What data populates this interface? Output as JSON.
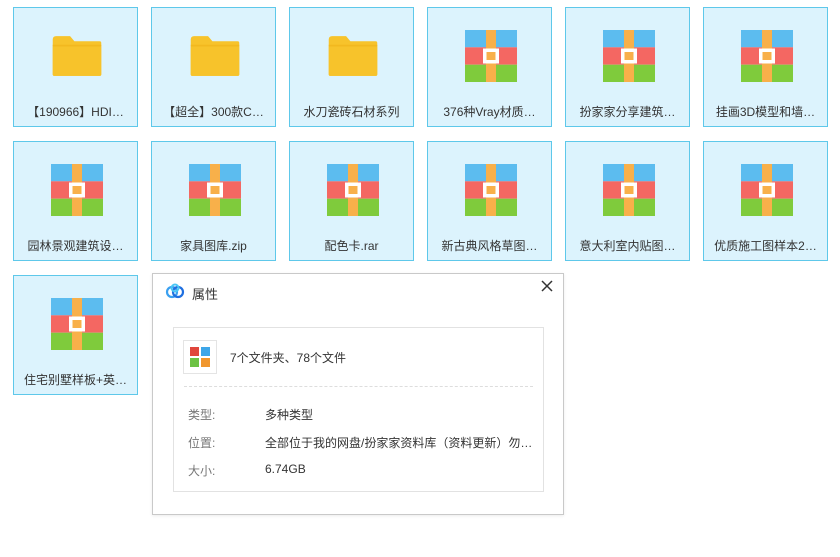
{
  "items": [
    {
      "label": "【190966】HDI…",
      "type": "folder"
    },
    {
      "label": "【超全】300款C…",
      "type": "folder"
    },
    {
      "label": "水刀瓷砖石材系列",
      "type": "folder"
    },
    {
      "label": "376种Vray材质…",
      "type": "archive"
    },
    {
      "label": "扮家家分享建筑…",
      "type": "archive"
    },
    {
      "label": "挂画3D模型和墙…",
      "type": "archive"
    },
    {
      "label": "园林景观建筑设…",
      "type": "archive"
    },
    {
      "label": "家具图库.zip",
      "type": "archive"
    },
    {
      "label": "配色卡.rar",
      "type": "archive"
    },
    {
      "label": "新古典风格草图…",
      "type": "archive"
    },
    {
      "label": "意大利室内贴图…",
      "type": "archive"
    },
    {
      "label": "优质施工图样本2…",
      "type": "archive"
    },
    {
      "label": "住宅别墅样板+英…",
      "type": "archive"
    }
  ],
  "dialog": {
    "title": "属性",
    "title_icon": "baidu-netdisk-cloud-icon",
    "close_icon": "close-icon",
    "summary": "7个文件夹、78个文件",
    "summary_icon": "multi-type-files-icon",
    "type_label": "类型:",
    "type_value": "多种类型",
    "location_label": "位置:",
    "location_value": "全部位于我的网盘/扮家家资料库（资料更新）勿…",
    "size_label": "大小:",
    "size_value": "6.74GB"
  },
  "colors": {
    "tile_bg": "#dcf3fd",
    "tile_border": "#5ec8ea",
    "folder": "#f7c32b",
    "archive_top": "#5cbcef",
    "archive_mid": "#f46762",
    "archive_bottom": "#7fcb3c",
    "archive_strap": "#f8b04a"
  }
}
